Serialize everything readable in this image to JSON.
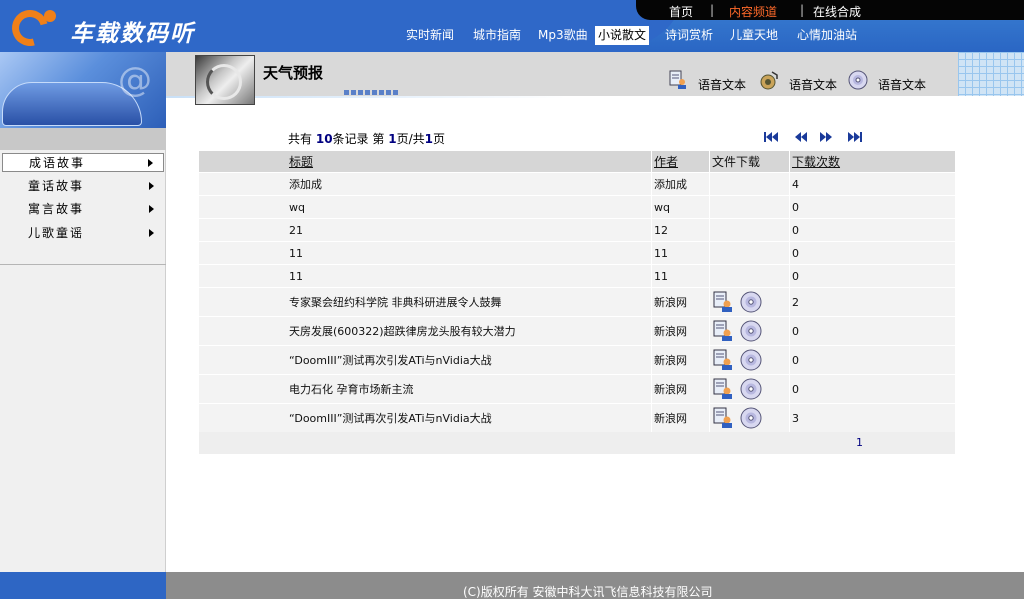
{
  "brand": {
    "name": "车载数码听"
  },
  "topbar": {
    "links": [
      "首页",
      "内容频道",
      "在线合成"
    ],
    "active": "内容频道"
  },
  "nav": {
    "items": [
      "实时新闻",
      "城市指南",
      "Mp3歌曲",
      "小说散文",
      "诗词赏析",
      "儿童天地",
      "心情加油站"
    ],
    "active": "小说散文"
  },
  "sidebar": {
    "items": [
      "成语故事",
      "童话故事",
      "寓言故事",
      "儿歌童谣"
    ],
    "selected": "成语故事"
  },
  "page": {
    "title": "天气预报"
  },
  "voice_links": [
    "语音文本",
    "语音文本",
    "语音文本"
  ],
  "paging": {
    "prefix": "共有",
    "total": "10",
    "total_suffix": "条记录 第",
    "current": "1",
    "page_sep": "页/共",
    "pages": "1",
    "page_suffix": "页",
    "page_number": "1"
  },
  "table": {
    "headers": {
      "title": "标题",
      "author": "作者",
      "file": "文件下载",
      "count": "下载次数"
    },
    "rows": [
      {
        "title": "添加成",
        "author": "添加成",
        "count": "4",
        "has_files": false
      },
      {
        "title": "wq",
        "author": "wq",
        "count": "0",
        "has_files": false
      },
      {
        "title": "21",
        "author": "12",
        "count": "0",
        "has_files": false
      },
      {
        "title": "11",
        "author": "11",
        "count": "0",
        "has_files": false
      },
      {
        "title": "11",
        "author": "11",
        "count": "0",
        "has_files": false
      },
      {
        "title": "专家聚会纽约科学院 非典科研进展令人鼓舞",
        "author": "新浪网",
        "count": "2",
        "has_files": true
      },
      {
        "title": "天房发展(600322)超跌律房龙头股有较大潜力",
        "author": "新浪网",
        "count": "0",
        "has_files": true
      },
      {
        "title": "“DoomIII”测试再次引发ATi与nVidia大战",
        "author": "新浪网",
        "count": "0",
        "has_files": true
      },
      {
        "title": "电力石化 孕育市场新主流",
        "author": "新浪网",
        "count": "0",
        "has_files": true
      },
      {
        "title": "“DoomIII”测试再次引发ATi与nVidia大战",
        "author": "新浪网",
        "count": "3",
        "has_files": true
      }
    ]
  },
  "footer": {
    "copyright": "(C)版权所有 安徽中科大讯飞信息科技有限公司"
  },
  "icons": {
    "logo": "orbit-logo-icon",
    "text_file": "document-person-icon",
    "audio_file": "cd-disc-icon",
    "music": "speaker-icon",
    "pager": [
      "first-page-icon",
      "prev-page-icon",
      "next-page-icon",
      "last-page-icon"
    ]
  },
  "colors": {
    "header_blue": "#2f68c8",
    "accent_orange": "#f08019",
    "active_link": "#ff6a2a",
    "footer_gray": "#8c8c8c",
    "page_number": "#000080"
  }
}
